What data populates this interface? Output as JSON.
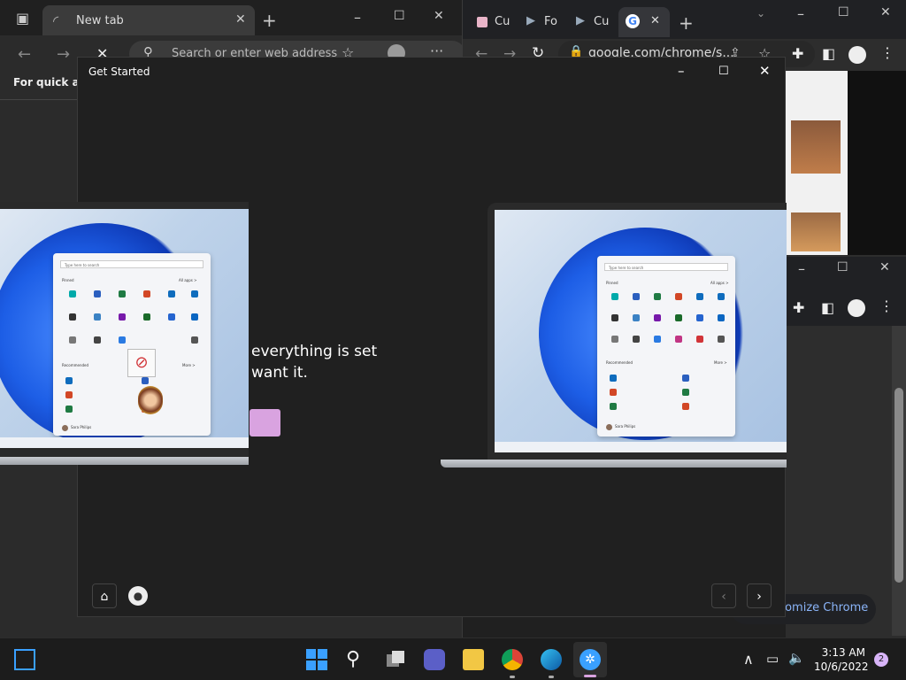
{
  "edge": {
    "tab_title": "New tab",
    "address_placeholder": "Search or enter web address",
    "favorites_hint": "For quick acc"
  },
  "chrome_top": {
    "tabs": [
      "Cu",
      "Fo",
      "Cu",
      ""
    ],
    "address": "google.com/chrome/s..."
  },
  "chrome_side": {
    "customize_label": "tomize Chrome"
  },
  "get_started": {
    "title": "Get Started",
    "line1": "everything is set",
    "line2": "want it."
  },
  "laptop_screen": {
    "search_placeholder": "Type here to search",
    "pinned_label": "Pinned",
    "all_apps_label": "All apps >",
    "recommended_label": "Recommended",
    "more_label": "More >",
    "user_name": "Sara Philips",
    "pinned_apps": [
      "Edge",
      "Word",
      "Excel",
      "PowerPoint",
      "Mail",
      "Calendar",
      "Microsoft Store",
      "Photos",
      "OneNote",
      "Solitaire",
      "To Do",
      "LinkedIn",
      "Settings",
      "Calculator",
      "Whiteboard",
      "Clipchamp",
      "Movies & TV",
      "Clock"
    ],
    "recommended": [
      {
        "name": "Get Started",
        "sub": "Welcome to Windows"
      },
      {
        "name": "Travel Itinerary",
        "sub": "17m ago"
      },
      {
        "name": "Brand Guidelines",
        "sub": "2h ago"
      },
      {
        "name": "Expense Worksheet",
        "sub": "12h ago"
      },
      {
        "name": "Quarterly Payroll Report",
        "sub": "Yesterday at 4:24 PM"
      },
      {
        "name": "Adatum Company Profile",
        "sub": "Yesterday at 1:15 PM"
      }
    ]
  },
  "taskbar": {
    "time": "3:13 AM",
    "date": "10/6/2022",
    "notification_count": "2"
  },
  "colors": {
    "accent_pink": "#d9a3e0",
    "link_blue": "#8ab4f8",
    "win_blue": "#1d5ee6"
  }
}
